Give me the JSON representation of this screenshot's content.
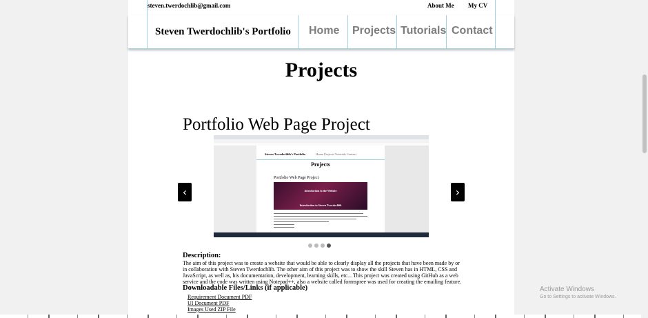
{
  "header": {
    "email": "steven.twerdochlib@gmail.com",
    "top_links": [
      "About Me",
      "My CV"
    ],
    "brand": "Steven Twerdochlib's Portfolio",
    "nav": [
      "Home",
      "Projects",
      "Tutorials",
      "Contact"
    ]
  },
  "main": {
    "heading": "Projects",
    "project_title": "Portfolio Web Page Project",
    "carousel": {
      "prev_icon": "chevron-left-icon",
      "next_icon": "chevron-right-icon",
      "prev_glyph": "‹",
      "next_glyph": "›",
      "slide_count": 4,
      "active_slide": 4,
      "screenshot": {
        "brand": "Steven Twerdochlib's Portfolio",
        "links": "Home  Projects  Tutorials  Contact",
        "heading": "Projects",
        "project_title": "Portfolio Web Page Project",
        "slide_title": "Introduction to the Website",
        "slide_subtitle": "Introduction to Steven Twerdochlib"
      }
    },
    "description_heading": "Description:",
    "description": "The aim of this project was to create a website that would be able to clearly display all the projects that have been made by or in collaboration with Steven Twerdochlib. The other aim of this project was to show the skill Steven has in HTML, CSS and JavaScript, as well as, his documentation, development, learning skills, etc... This project was created using GitHub as a web service and the code was written using Notepad++, also a website called formspree was used for creating the emailing feature.",
    "downloads_heading": "Downloadable Files/Links (if applicable)",
    "downloads": [
      "Requirement Document PDF",
      "UI Document PDF",
      "Images Used ZIP File"
    ]
  },
  "windows_overlay": {
    "title": "Activate Windows",
    "subtitle": "Go to Settings to activate Windows."
  }
}
